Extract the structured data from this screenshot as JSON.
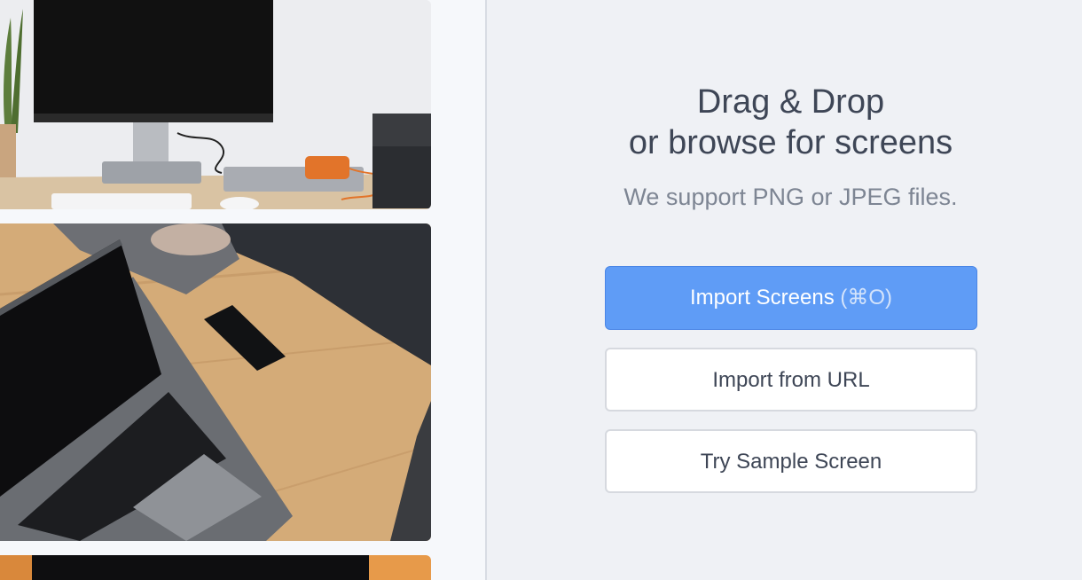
{
  "gallery": {
    "items": [
      {
        "alt": "desk-monitor-photo"
      },
      {
        "alt": "laptop-on-wooden-desk-photo"
      },
      {
        "alt": "partial-photo"
      }
    ]
  },
  "dropzone": {
    "title_line1": "Drag & Drop",
    "title_line2": "or browse for screens",
    "subtitle": "We support PNG or JPEG files.",
    "import_button": {
      "label": "Import Screens",
      "shortcut": "(⌘O)"
    },
    "url_button": {
      "label": "Import from URL"
    },
    "sample_button": {
      "label": "Try Sample Screen"
    }
  },
  "colors": {
    "primary": "#5f9cf6",
    "text": "#3e4656",
    "muted": "#7d8593",
    "background": "#eff1f5"
  }
}
